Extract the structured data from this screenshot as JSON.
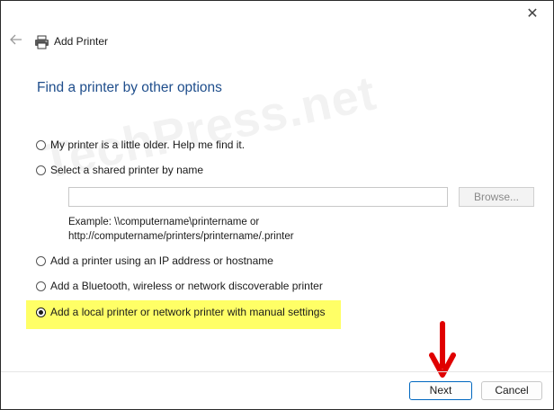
{
  "window": {
    "close_glyph": "✕"
  },
  "header": {
    "back_icon": "arrow-left-icon",
    "printer_icon": "printer-icon",
    "title": "Add Printer"
  },
  "heading": "Find a printer by other options",
  "options": [
    {
      "label": "My printer is a little older. Help me find it.",
      "selected": false
    },
    {
      "label": "Select a shared printer by name",
      "selected": false
    },
    {
      "label": "Add a printer using an IP address or hostname",
      "selected": false
    },
    {
      "label": "Add a Bluetooth, wireless or network discoverable printer",
      "selected": false
    },
    {
      "label": "Add a local printer or network printer with manual settings",
      "selected": true
    }
  ],
  "shared_printer": {
    "value": "",
    "browse_label": "Browse...",
    "example_line1": "Example: \\\\computername\\printername or",
    "example_line2": "http://computername/printers/printername/.printer"
  },
  "watermark": "TechPress.net",
  "buttons": {
    "next": "Next",
    "cancel": "Cancel"
  },
  "colors": {
    "heading": "#1f4e8c",
    "highlight": "#ffff66",
    "annotation_arrow": "#e00000",
    "primary_border": "#0067c0"
  }
}
